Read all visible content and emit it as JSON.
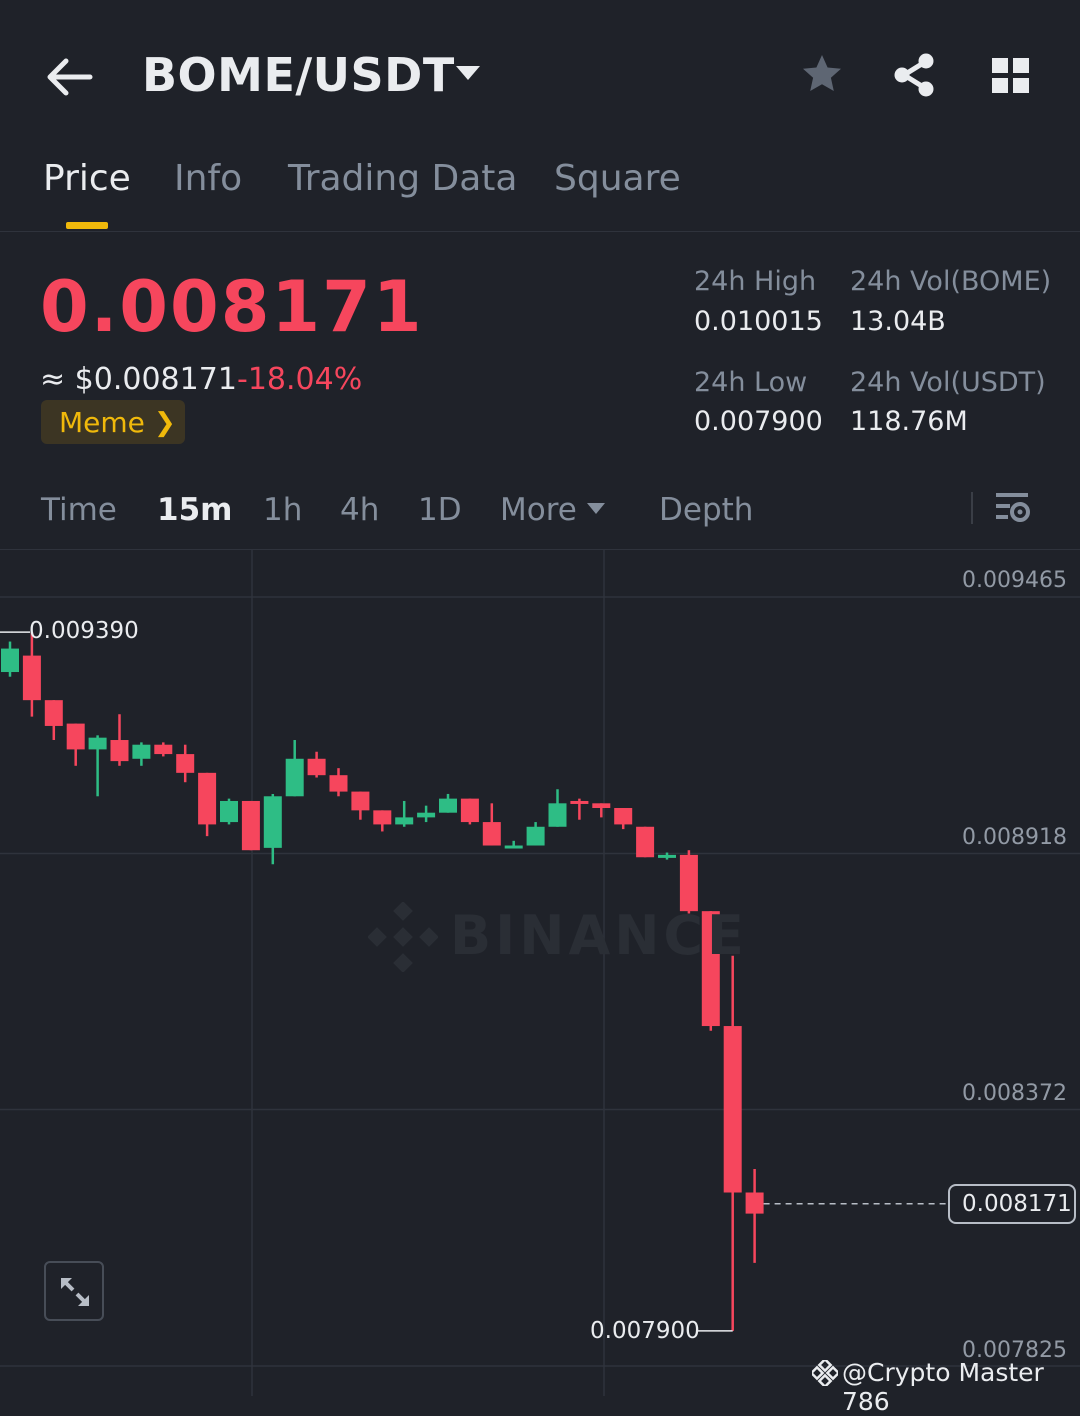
{
  "header": {
    "pair": "BOME/USDT",
    "icons": [
      "back-arrow-icon",
      "caret-down-icon",
      "star-icon",
      "share-icon",
      "grid-icon"
    ]
  },
  "tabs": [
    {
      "label": "Price",
      "active": true
    },
    {
      "label": "Info",
      "active": false
    },
    {
      "label": "Trading Data",
      "active": false
    },
    {
      "label": "Square",
      "active": false
    }
  ],
  "ticker": {
    "last_price": "0.008171",
    "usd_price": "≈ $0.008171",
    "change_pct": "-18.04%",
    "tag": "Meme",
    "stats": {
      "high_label": "24h High",
      "high_value": "0.010015",
      "vol_base_label": "24h Vol(BOME)",
      "vol_base_value": "13.04B",
      "low_label": "24h Low",
      "low_value": "0.007900",
      "vol_quote_label": "24h Vol(USDT)",
      "vol_quote_value": "118.76M"
    }
  },
  "timeframes": {
    "items": [
      {
        "label": "Time",
        "active": false
      },
      {
        "label": "15m",
        "active": true
      },
      {
        "label": "1h",
        "active": false
      },
      {
        "label": "4h",
        "active": false
      },
      {
        "label": "1D",
        "active": false
      },
      {
        "label": "More",
        "active": false
      },
      {
        "label": "Depth",
        "active": false
      }
    ]
  },
  "chart_data": {
    "type": "candlestick",
    "interval": "15m",
    "ylim": [
      0.0078,
      0.0095
    ],
    "y_ticks": [
      "0.009465",
      "0.008918",
      "0.008372",
      "0.007825"
    ],
    "high_marker": "0.009390",
    "low_marker": "0.007900",
    "current_price": "0.008171",
    "watermark": "BINANCE",
    "colors": {
      "up": "#2ebd85",
      "down": "#f6465d",
      "background": "#1f2229"
    },
    "candles": [
      {
        "o": 0.009305,
        "h": 0.00937,
        "c": 0.009355,
        "l": 0.009295
      },
      {
        "o": 0.00934,
        "h": 0.00939,
        "c": 0.009245,
        "l": 0.00921
      },
      {
        "o": 0.009245,
        "h": 0.009245,
        "c": 0.00919,
        "l": 0.00916
      },
      {
        "o": 0.009195,
        "h": 0.009195,
        "c": 0.00914,
        "l": 0.009105
      },
      {
        "o": 0.00914,
        "h": 0.00917,
        "c": 0.009165,
        "l": 0.00904
      },
      {
        "o": 0.00916,
        "h": 0.009215,
        "c": 0.009115,
        "l": 0.009105
      },
      {
        "o": 0.00912,
        "h": 0.009155,
        "c": 0.00915,
        "l": 0.009105
      },
      {
        "o": 0.00915,
        "h": 0.009155,
        "c": 0.00913,
        "l": 0.009125
      },
      {
        "o": 0.00913,
        "h": 0.00915,
        "c": 0.00909,
        "l": 0.00907
      },
      {
        "o": 0.00909,
        "h": 0.00909,
        "c": 0.00898,
        "l": 0.008955
      },
      {
        "o": 0.008985,
        "h": 0.009035,
        "c": 0.00903,
        "l": 0.00898
      },
      {
        "o": 0.00903,
        "h": 0.00903,
        "c": 0.008925,
        "l": 0.008925
      },
      {
        "o": 0.00893,
        "h": 0.009045,
        "c": 0.00904,
        "l": 0.008895
      },
      {
        "o": 0.00904,
        "h": 0.00916,
        "c": 0.00912,
        "l": 0.00904
      },
      {
        "o": 0.00912,
        "h": 0.009135,
        "c": 0.009085,
        "l": 0.00908
      },
      {
        "o": 0.009085,
        "h": 0.0091,
        "c": 0.00905,
        "l": 0.00904
      },
      {
        "o": 0.00905,
        "h": 0.00905,
        "c": 0.00901,
        "l": 0.00899
      },
      {
        "o": 0.00901,
        "h": 0.00901,
        "c": 0.00898,
        "l": 0.008965
      },
      {
        "o": 0.00898,
        "h": 0.00903,
        "c": 0.008995,
        "l": 0.008975
      },
      {
        "o": 0.008995,
        "h": 0.00902,
        "c": 0.009005,
        "l": 0.008985
      },
      {
        "o": 0.009005,
        "h": 0.009045,
        "c": 0.009035,
        "l": 0.009005
      },
      {
        "o": 0.009035,
        "h": 0.009035,
        "c": 0.008985,
        "l": 0.00898
      },
      {
        "o": 0.008985,
        "h": 0.009025,
        "c": 0.008935,
        "l": 0.008935
      },
      {
        "o": 0.008935,
        "h": 0.008945,
        "c": 0.008935,
        "l": 0.00893
      },
      {
        "o": 0.008935,
        "h": 0.008985,
        "c": 0.008975,
        "l": 0.008935
      },
      {
        "o": 0.008975,
        "h": 0.009055,
        "c": 0.009025,
        "l": 0.008975
      },
      {
        "o": 0.00903,
        "h": 0.009035,
        "c": 0.009025,
        "l": 0.00899
      },
      {
        "o": 0.009025,
        "h": 0.009025,
        "c": 0.009015,
        "l": 0.008995
      },
      {
        "o": 0.009015,
        "h": 0.009015,
        "c": 0.00898,
        "l": 0.00897
      },
      {
        "o": 0.008975,
        "h": 0.008975,
        "c": 0.00891,
        "l": 0.00891
      },
      {
        "o": 0.008915,
        "h": 0.00892,
        "c": 0.008915,
        "l": 0.008905
      },
      {
        "o": 0.008915,
        "h": 0.008925,
        "c": 0.008795,
        "l": 0.00879
      },
      {
        "o": 0.008795,
        "h": 0.008795,
        "c": 0.00855,
        "l": 0.00854
      },
      {
        "o": 0.00855,
        "h": 0.0087,
        "c": 0.008195,
        "l": 0.0079
      },
      {
        "o": 0.008195,
        "h": 0.008245,
        "c": 0.00815,
        "l": 0.008045
      }
    ]
  },
  "footer": {
    "credit": "@Crypto Master 786"
  }
}
